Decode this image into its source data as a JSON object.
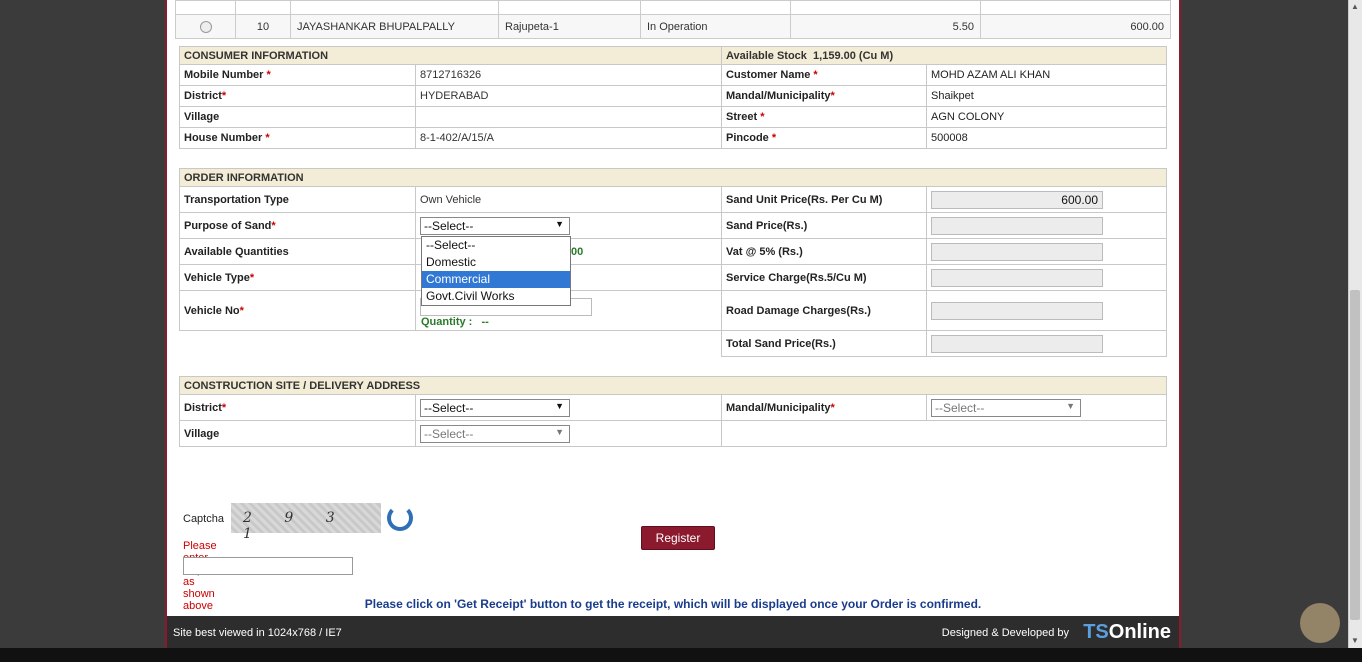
{
  "prev_table": {
    "row": {
      "sno": "10",
      "district": "JAYASHANKAR BHUPALPALLY",
      "stockyard": "Rajupeta-1",
      "status": "In Operation",
      "qty": "5.50",
      "price": "600.00"
    }
  },
  "consumer": {
    "header": "CONSUMER INFORMATION",
    "stock_label": "Available Stock",
    "stock_value": "1,159.00  (Cu M)",
    "mobile_label": "Mobile Number",
    "mobile_value": "8712716326",
    "customer_label": "Customer Name",
    "customer_value": "MOHD AZAM ALI KHAN",
    "district_label": "District",
    "district_value": "HYDERABAD",
    "mandal_label": "Mandal/Municipality",
    "mandal_value": "Shaikpet",
    "village_label": "Village",
    "village_value": "",
    "street_label": "Street",
    "street_value": "AGN COLONY",
    "house_label": "House Number",
    "house_value": "8-1-402/A/15/A",
    "pincode_label": "Pincode",
    "pincode_value": "500008"
  },
  "order": {
    "header": "ORDER INFORMATION",
    "transport_label": "Transportation Type",
    "transport_value": "Own Vehicle",
    "unit_price_label": "Sand Unit Price(Rs. Per Cu M)",
    "unit_price_value": "600.00",
    "purpose_label": "Purpose of Sand",
    "purpose_value": "--Select--",
    "sand_price_label": "Sand Price(Rs.)",
    "avail_qty_label": "Available Quantities",
    "avail_qty_value": "00",
    "vat_label": "Vat @ 5% (Rs.)",
    "vehicle_type_label": "Vehicle Type",
    "service_label": "Service Charge(Rs.5/Cu M)",
    "vehicle_no_label": "Vehicle No",
    "quantity_label": "Quantity :",
    "quantity_value": "--",
    "road_label": "Road Damage Charges(Rs.)",
    "total_label": "Total Sand Price(Rs.)",
    "purpose_options": [
      "--Select--",
      "Domestic",
      "Commercial",
      "Govt.Civil Works"
    ],
    "purpose_highlighted": "Commercial"
  },
  "delivery": {
    "header": "CONSTRUCTION SITE / DELIVERY ADDRESS",
    "district_label": "District",
    "district_value": "--Select--",
    "mandal_label": "Mandal/Municipality",
    "mandal_value": "--Select--",
    "village_label": "Village",
    "village_value": "--Select--"
  },
  "captcha": {
    "label": "Captcha",
    "code": "2 9 3 1",
    "message": "Please enter Captcha as shown above"
  },
  "register_label": "Register",
  "notice": "Please click on 'Get Receipt' button to get the receipt, which will be displayed once your Order is confirmed.",
  "footer": {
    "left": "Site best viewed in 1024x768 / IE7",
    "right": "Designed & Developed by",
    "logo_a": "TS",
    "logo_b": "Online"
  },
  "required_mark": "*"
}
